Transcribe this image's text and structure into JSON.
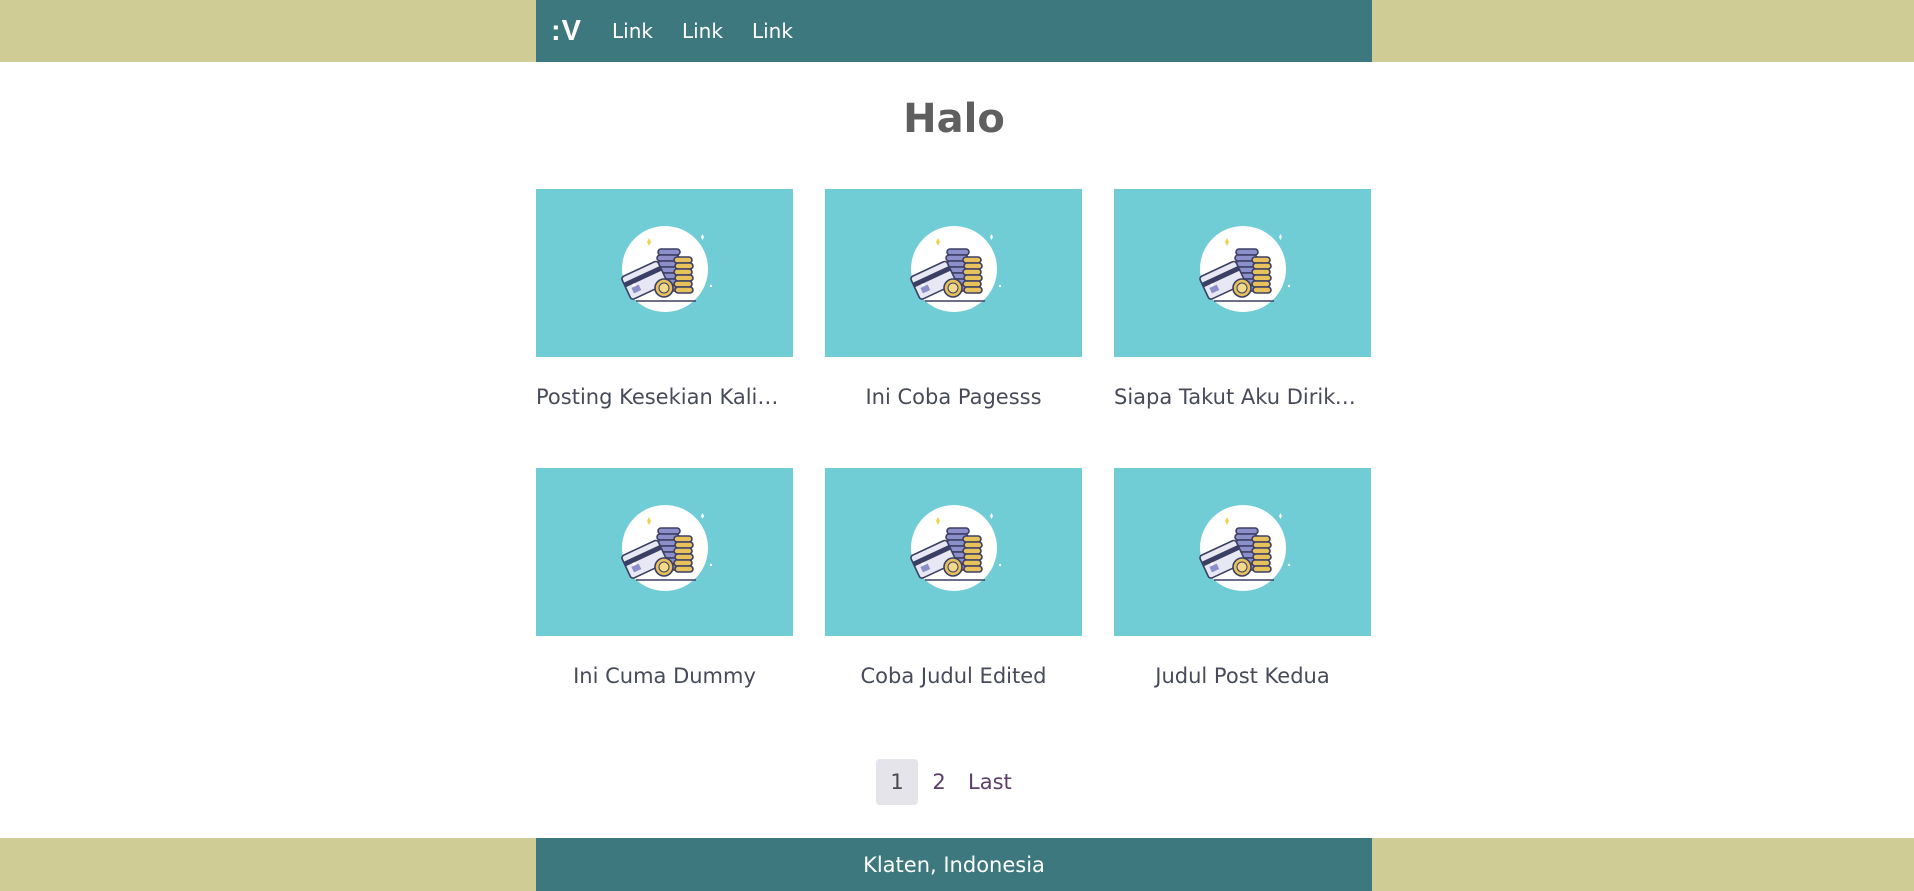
{
  "navbar": {
    "brand": ":V",
    "links": [
      "Link",
      "Link",
      "Link"
    ]
  },
  "page": {
    "title": "Halo"
  },
  "posts": [
    {
      "title": "Posting Kesekian Kalinya ..."
    },
    {
      "title": "Ini Coba Pagesss"
    },
    {
      "title": "Siapa Takut Aku Diriku Ka..."
    },
    {
      "title": "Ini Cuma Dummy"
    },
    {
      "title": "Coba Judul Edited"
    },
    {
      "title": "Judul Post Kedua"
    }
  ],
  "thumbnail": {
    "icon": "coins-credit-card-icon",
    "background_color": "#70cdd6"
  },
  "pagination": {
    "pages": [
      "1",
      "2"
    ],
    "last_label": "Last",
    "active_page": "1"
  },
  "footer": {
    "text": "Klaten, Indonesia"
  },
  "colors": {
    "navbar": "#3d787e",
    "side_bands": "#cfcd95"
  }
}
